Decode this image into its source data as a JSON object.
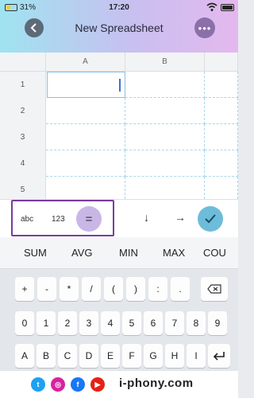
{
  "status": {
    "battery_pct": "31%",
    "time": "17:20"
  },
  "header": {
    "title": "New Spreadsheet",
    "back_icon": "chevron-left-icon",
    "more_icon": "ellipsis-icon"
  },
  "grid": {
    "columns": [
      "A",
      "B"
    ],
    "rows": [
      "1",
      "2",
      "3",
      "4",
      "5"
    ],
    "selected_cell": "A1"
  },
  "toolbar": {
    "modes": [
      "abc",
      "123",
      "="
    ],
    "active_mode": "=",
    "down_arrow": "↓",
    "right_arrow": "→",
    "confirm_icon": "checkmark-icon"
  },
  "keyboard": {
    "functions": [
      "SUM",
      "AVG",
      "MIN",
      "MAX",
      "COU"
    ],
    "symbols": [
      "+",
      "-",
      "*",
      "/",
      "(",
      ")",
      ":",
      "."
    ],
    "digits": [
      "0",
      "1",
      "2",
      "3",
      "4",
      "5",
      "6",
      "7",
      "8",
      "9"
    ],
    "letters": [
      "A",
      "B",
      "C",
      "D",
      "E",
      "F",
      "G",
      "H",
      "I"
    ],
    "backspace_icon": "backspace-icon",
    "return_icon": "return-icon"
  },
  "footer": {
    "brand": "i-phony.com",
    "social": [
      "twitter-icon",
      "instagram-icon",
      "facebook-icon",
      "youtube-icon"
    ],
    "colors": {
      "twitter": "#1da1f2",
      "instagram": "#d6249f",
      "facebook": "#1877f2",
      "youtube": "#e62117"
    }
  },
  "theme": {
    "accent": "#7a3c9c",
    "confirm": "#6dbcd9",
    "header_start": "#9fe3f0",
    "header_end": "#e4b8ee"
  }
}
